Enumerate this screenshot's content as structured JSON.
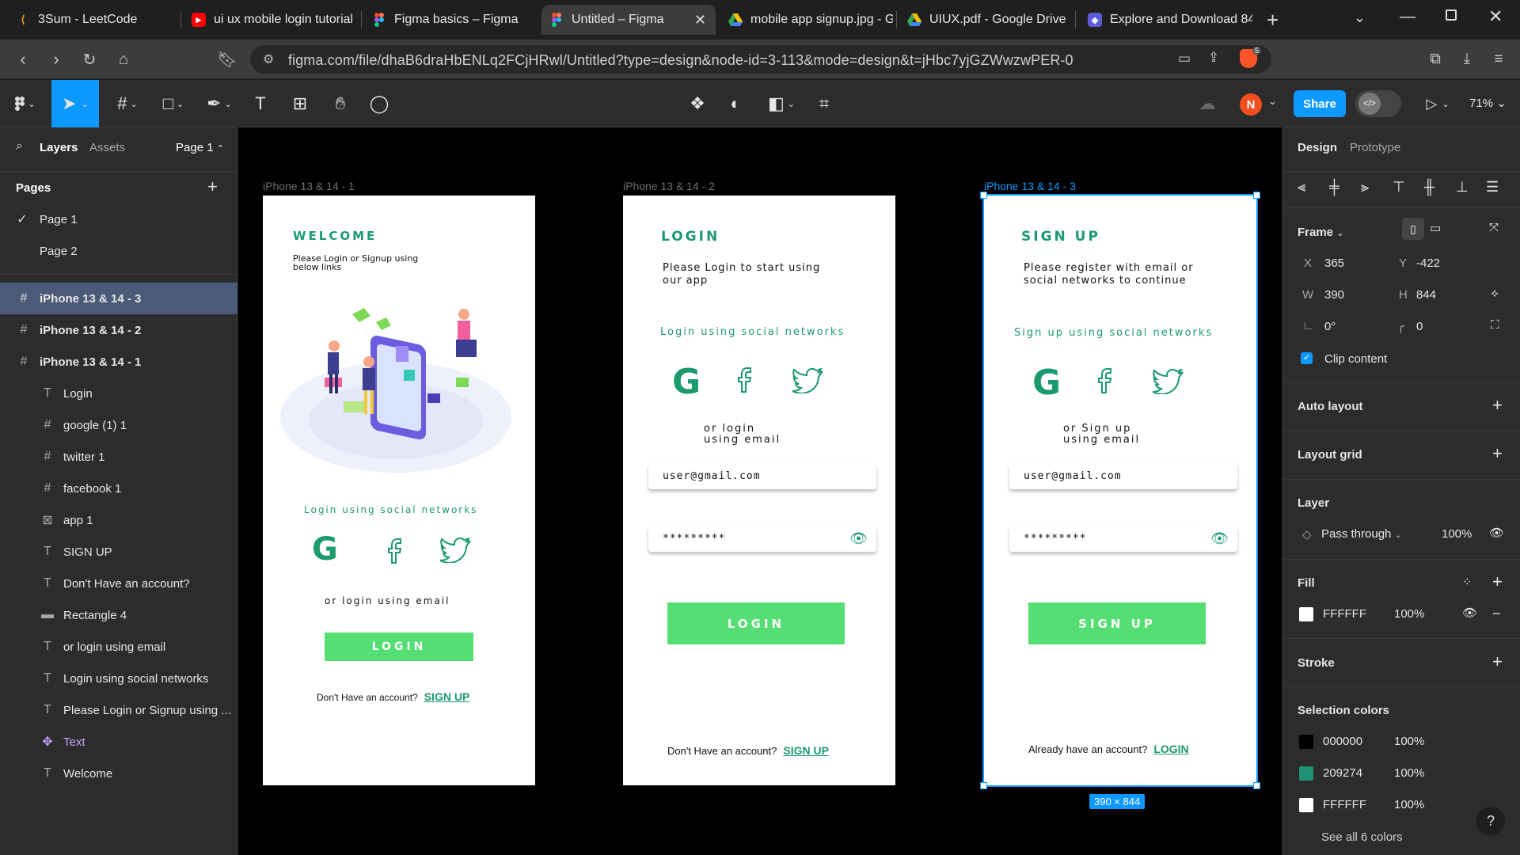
{
  "browser": {
    "tabs": [
      {
        "title": "3Sum - LeetCode",
        "icon": "leetcode-icon"
      },
      {
        "title": "ui ux mobile login tutorial",
        "icon": "youtube-icon"
      },
      {
        "title": "Figma basics – Figma",
        "icon": "figma-icon"
      },
      {
        "title": "Untitled – Figma",
        "icon": "figma-icon",
        "active": true
      },
      {
        "title": "mobile app signup.jpg - G",
        "icon": "google-drive-icon"
      },
      {
        "title": "UIUX.pdf - Google Drive",
        "icon": "google-drive-icon"
      },
      {
        "title": "Explore and Download 84",
        "icon": "app-icon"
      }
    ],
    "url": "figma.com/file/dhaB6draHbENLq2FCjHRwl/Untitled?type=design&node-id=3-113&mode=design&t=jHbc7yjGZWwzwPER-0",
    "brave_badge": "5"
  },
  "toolbar": {
    "share_label": "Share",
    "avatar_initial": "N",
    "zoom": "71%"
  },
  "left_panel": {
    "tab_layers": "Layers",
    "tab_assets": "Assets",
    "page_selector": "Page 1",
    "pages_title": "Pages",
    "pages": [
      "Page 1",
      "Page 2"
    ],
    "layers": [
      {
        "name": "iPhone 13 & 14 - 3",
        "kind": "frame",
        "level": 0,
        "selected": true
      },
      {
        "name": "iPhone 13 & 14 - 2",
        "kind": "frame",
        "level": 0
      },
      {
        "name": "iPhone 13 & 14 - 1",
        "kind": "frame",
        "level": 0
      },
      {
        "name": "Login",
        "kind": "text",
        "level": 1
      },
      {
        "name": "google (1) 1",
        "kind": "frame",
        "level": 1
      },
      {
        "name": "twitter 1",
        "kind": "frame",
        "level": 1
      },
      {
        "name": "facebook 1",
        "kind": "frame",
        "level": 1
      },
      {
        "name": "app 1",
        "kind": "image",
        "level": 1
      },
      {
        "name": "SIGN UP",
        "kind": "text",
        "level": 1
      },
      {
        "name": "Don't Have an account?",
        "kind": "text",
        "level": 1
      },
      {
        "name": "Rectangle 4",
        "kind": "rect",
        "level": 1
      },
      {
        "name": "or login using email",
        "kind": "text",
        "level": 1
      },
      {
        "name": "Login using social networks",
        "kind": "text",
        "level": 1
      },
      {
        "name": "Please Login or Signup using ...",
        "kind": "text",
        "level": 1
      },
      {
        "name": "Text",
        "kind": "component",
        "level": 1
      },
      {
        "name": "Welcome",
        "kind": "text",
        "level": 1
      }
    ]
  },
  "canvas": {
    "size_badge": "390 × 844",
    "frames": [
      {
        "label": "iPhone 13 & 14 - 1",
        "heading": "WELCOME",
        "subtitle_1": "Please Login or Signup using",
        "subtitle_2": "below links",
        "social_text": "Login using social networks",
        "or_text": "or login using email",
        "button": "LOGIN",
        "footer_text": "Don't Have an account?",
        "footer_link": "SIGN UP"
      },
      {
        "label": "iPhone 13 & 14 - 2",
        "heading": "LOGIN",
        "subtitle_1": "Please Login to start using",
        "subtitle_2": "our app",
        "social_text": "Login using social networks",
        "or_text_1": "or login",
        "or_text_2": "using email",
        "email": "user@gmail.com",
        "password": "*********",
        "button": "LOGIN",
        "footer_text": "Don't Have an account?",
        "footer_link": "SIGN UP"
      },
      {
        "label": "iPhone 13 & 14 - 3",
        "heading": "SIGN UP",
        "subtitle_1": "Please register with email or",
        "subtitle_2": "social networks to continue",
        "social_text": "Sign up using social networks",
        "or_text_1": "or Sign up",
        "or_text_2": "using email",
        "email": "user@gmail.com",
        "password": "*********",
        "button": "SIGN UP",
        "footer_text": "Already have an account?",
        "footer_link": "LOGIN"
      }
    ]
  },
  "right_panel": {
    "tab_design": "Design",
    "tab_prototype": "Prototype",
    "frame_title": "Frame",
    "x_label": "X",
    "x": "365",
    "y_label": "Y",
    "y": "-422",
    "w_label": "W",
    "w": "390",
    "h_label": "H",
    "h": "844",
    "rotation": "0°",
    "radius": "0",
    "clip_content": "Clip content",
    "auto_layout": "Auto layout",
    "layout_grid": "Layout grid",
    "layer_title": "Layer",
    "blend": "Pass through",
    "layer_opacity": "100%",
    "fill_title": "Fill",
    "fill_hex": "FFFFFF",
    "fill_opacity": "100%",
    "stroke_title": "Stroke",
    "selection_colors_title": "Selection colors",
    "selection_colors": [
      {
        "hex": "000000",
        "opacity": "100%",
        "swatch": "#000000"
      },
      {
        "hex": "209274",
        "opacity": "100%",
        "swatch": "#209274"
      },
      {
        "hex": "FFFFFF",
        "opacity": "100%",
        "swatch": "#FFFFFF"
      }
    ],
    "see_all": "See all 6 colors"
  },
  "colors": {
    "accent_blue": "#0d99ff",
    "brand_green": "#1b9a6c",
    "button_green": "#55de73"
  }
}
